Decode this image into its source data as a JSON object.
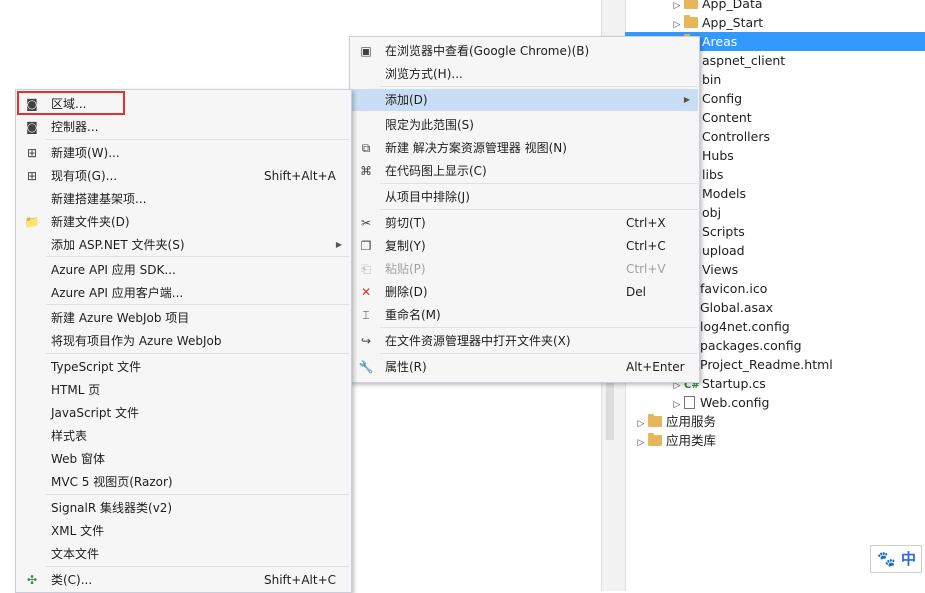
{
  "solution_explorer": {
    "items": [
      {
        "label": "App_Data",
        "type": "folder",
        "expand": true
      },
      {
        "label": "App_Start",
        "type": "folder",
        "expand": true
      },
      {
        "label": "Areas",
        "type": "folder",
        "selected": true
      },
      {
        "label": "aspnet_client",
        "type": "folder-dotted"
      },
      {
        "label": "bin",
        "type": "folder-dotted"
      },
      {
        "label": "Config",
        "type": "folder"
      },
      {
        "label": "Content",
        "type": "folder"
      },
      {
        "label": "Controllers",
        "type": "folder"
      },
      {
        "label": "Hubs",
        "type": "folder"
      },
      {
        "label": "libs",
        "type": "folder"
      },
      {
        "label": "Models",
        "type": "folder"
      },
      {
        "label": "obj",
        "type": "folder-dotted"
      },
      {
        "label": "Scripts",
        "type": "folder"
      },
      {
        "label": "upload",
        "type": "folder"
      },
      {
        "label": "Views",
        "type": "folder"
      },
      {
        "label": "favicon.ico",
        "type": "file"
      },
      {
        "label": "Global.asax",
        "type": "file"
      },
      {
        "label": "log4net.config",
        "type": "file"
      },
      {
        "label": "packages.config",
        "type": "file"
      },
      {
        "label": "Project_Readme.html",
        "type": "file"
      },
      {
        "label": "Startup.cs",
        "type": "cs",
        "expand": true
      },
      {
        "label": "Web.config",
        "type": "config",
        "expand": true
      },
      {
        "label": "应用服务",
        "type": "folder",
        "expand": true,
        "indent": 0
      },
      {
        "label": "应用类库",
        "type": "folder",
        "expand": true,
        "indent": 0
      }
    ]
  },
  "context_menu": {
    "items": [
      {
        "label": "在浏览器中查看(Google Chrome)(B)",
        "icon": "browser-icon",
        "glyph": "▣"
      },
      {
        "label": "浏览方式(H)...",
        "icon": "",
        "glyph": ""
      },
      {
        "label": "添加(D)",
        "icon": "",
        "glyph": "",
        "submenu": true,
        "highlight": true
      },
      {
        "label": "限定为此范围(S)",
        "icon": "",
        "glyph": ""
      },
      {
        "label": "新建 解决方案资源管理器 视图(N)",
        "icon": "new-view-icon",
        "glyph": "⧉"
      },
      {
        "label": "在代码图上显示(C)",
        "icon": "code-map-icon",
        "glyph": "⌘"
      },
      {
        "label": "从项目中排除(J)",
        "icon": "",
        "glyph": ""
      },
      {
        "label": "剪切(T)",
        "icon": "scissors-icon",
        "glyph": "✂",
        "shortcut": "Ctrl+X"
      },
      {
        "label": "复制(Y)",
        "icon": "copy-icon",
        "glyph": "❐",
        "shortcut": "Ctrl+C"
      },
      {
        "label": "粘贴(P)",
        "icon": "paste-icon",
        "glyph": "⎗",
        "shortcut": "Ctrl+V",
        "disabled": true
      },
      {
        "label": "删除(D)",
        "icon": "delete-x-icon",
        "glyph": "✕",
        "shortcut": "Del",
        "color": "#d6312b"
      },
      {
        "label": "重命名(M)",
        "icon": "rename-icon",
        "glyph": "⌶"
      },
      {
        "label": "在文件资源管理器中打开文件夹(X)",
        "icon": "open-folder-arrow-icon",
        "glyph": "↪"
      },
      {
        "label": "属性(R)",
        "icon": "wrench-icon",
        "glyph": "🔧",
        "shortcut": "Alt+Enter"
      }
    ]
  },
  "add_submenu": {
    "items": [
      {
        "label": "区域...",
        "icon": "area-icon",
        "glyph": "◙"
      },
      {
        "label": "控制器...",
        "icon": "controller-icon",
        "glyph": "◙"
      },
      {
        "label": "新建项(W)...",
        "icon": "new-item-icon",
        "glyph": "⊞"
      },
      {
        "label": "现有项(G)...",
        "icon": "existing-item-icon",
        "glyph": "⊞",
        "shortcut": "Shift+Alt+A"
      },
      {
        "label": "新建搭建基架项...",
        "icon": "",
        "glyph": ""
      },
      {
        "label": "新建文件夹(D)",
        "icon": "new-folder-icon",
        "glyph": "📁"
      },
      {
        "label": "添加 ASP.NET 文件夹(S)",
        "icon": "",
        "glyph": "",
        "submenu": true
      },
      {
        "label": "Azure API 应用 SDK...",
        "icon": "",
        "glyph": ""
      },
      {
        "label": "Azure API 应用客户端...",
        "icon": "",
        "glyph": ""
      },
      {
        "label": "新建 Azure WebJob 项目",
        "icon": "",
        "glyph": ""
      },
      {
        "label": "将现有项目作为 Azure WebJob",
        "icon": "",
        "glyph": ""
      },
      {
        "label": "TypeScript 文件",
        "icon": "",
        "glyph": ""
      },
      {
        "label": "HTML 页",
        "icon": "",
        "glyph": ""
      },
      {
        "label": "JavaScript 文件",
        "icon": "",
        "glyph": ""
      },
      {
        "label": "样式表",
        "icon": "",
        "glyph": ""
      },
      {
        "label": "Web 窗体",
        "icon": "",
        "glyph": ""
      },
      {
        "label": "MVC 5 视图页(Razor)",
        "icon": "",
        "glyph": ""
      },
      {
        "label": "SignalR 集线器类(v2)",
        "icon": "",
        "glyph": ""
      },
      {
        "label": "XML 文件",
        "icon": "",
        "glyph": ""
      },
      {
        "label": "文本文件",
        "icon": "",
        "glyph": ""
      },
      {
        "label": "类(C)...",
        "icon": "class-icon",
        "glyph": "✣",
        "shortcut": "Shift+Alt+C"
      }
    ]
  },
  "ime": {
    "mode": "中"
  }
}
